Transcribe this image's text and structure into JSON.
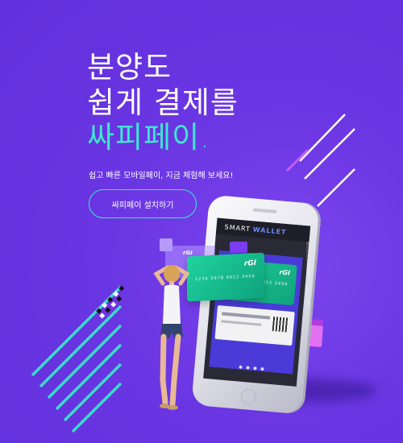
{
  "headline": {
    "line1": "분양도",
    "line2": "쉽게 결제를",
    "line3": "싸피페이."
  },
  "subtitle": "쉽고 빠른 모바일페이, 지금 체험해 보세요!",
  "cta": {
    "label": "싸피페이 설치하기"
  },
  "phone": {
    "brand_prefix": "SMART",
    "brand_suffix": "WALLET",
    "card_logo": "rGI",
    "card_number": "1234 5678 9012 3456"
  },
  "floating_card": {
    "logo": "rGI",
    "number": "1234 5678 9012 3456"
  },
  "colors": {
    "background": "#6a35e2",
    "accent": "#3fe5cf",
    "card_green": "#1fcf96"
  }
}
